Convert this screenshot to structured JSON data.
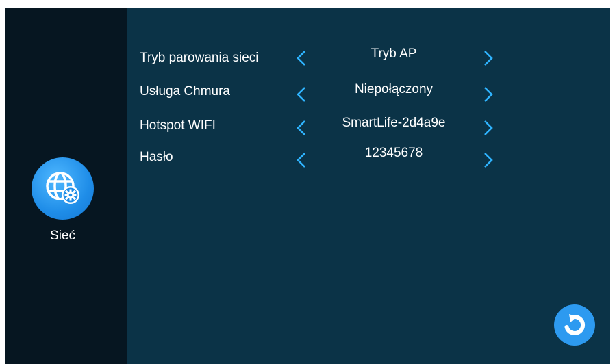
{
  "sidebar": {
    "network_label": "Sieć",
    "network_icon": "globe-gear-icon"
  },
  "settings": {
    "rows": [
      {
        "label": "Tryb parowania sieci",
        "value": "Tryb AP"
      },
      {
        "label": "Usługa Chmura",
        "value": "Niepołączony"
      },
      {
        "label": "Hotspot WIFI",
        "value": "SmartLife-2d4a9e"
      },
      {
        "label": "Hasło",
        "value": "12345678"
      }
    ]
  },
  "colors": {
    "sidebar_bg": "#061621",
    "main_bg": "#0b3347",
    "accent": "#1f8de8",
    "arrow": "#2fb4ff"
  },
  "actions": {
    "refresh_icon": "refresh-icon"
  }
}
